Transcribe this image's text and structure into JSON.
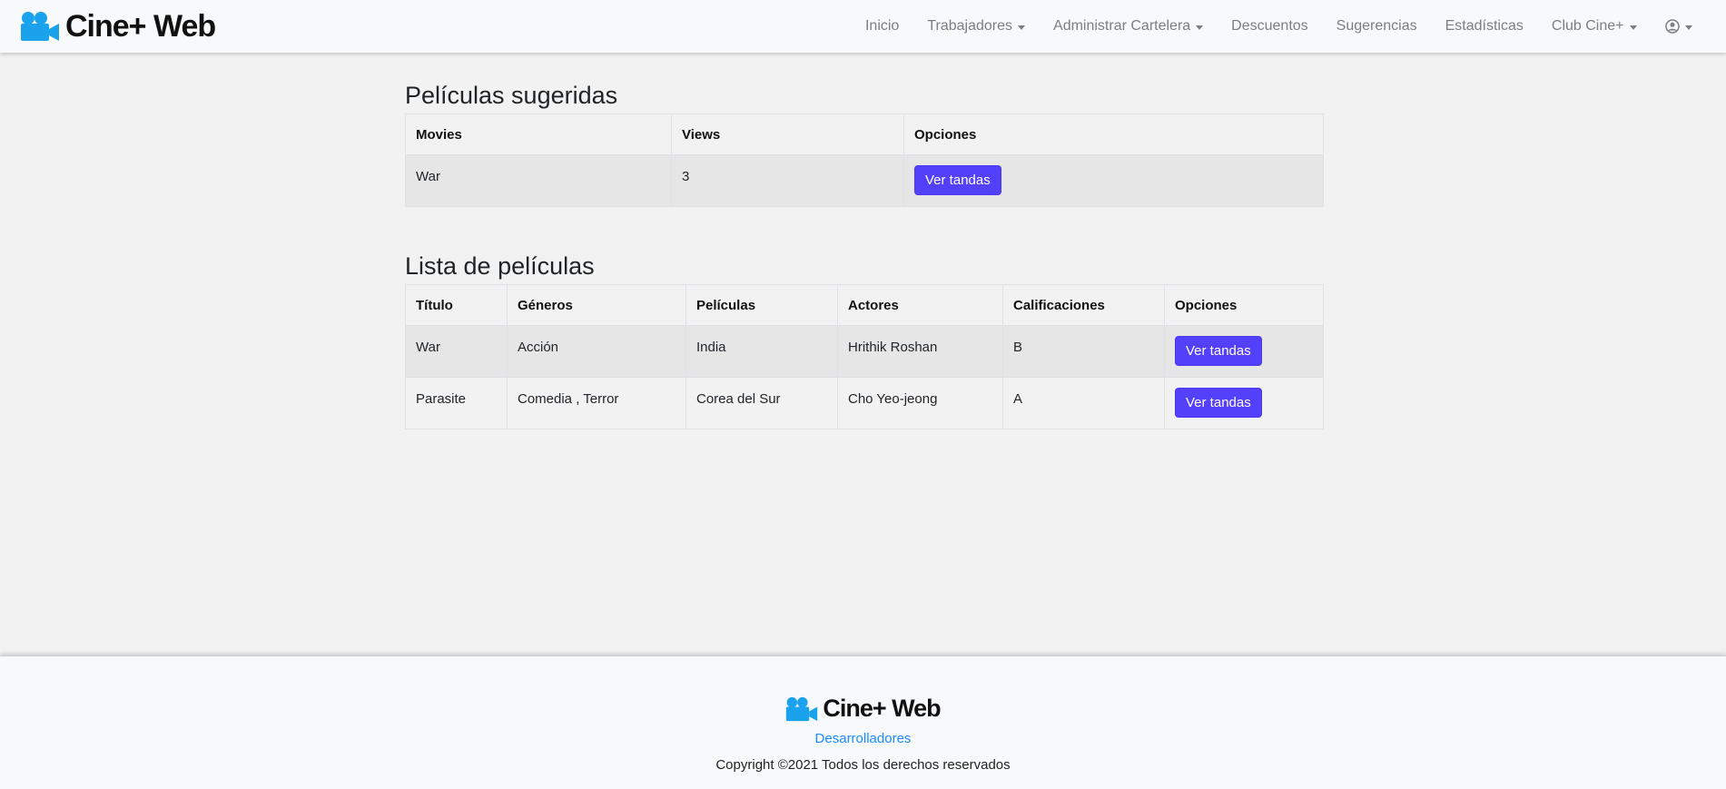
{
  "brand": {
    "name": "Cine+ Web",
    "icon": "movie-camera-icon",
    "color": "#1aa3ec"
  },
  "nav": {
    "items": [
      {
        "label": "Inicio",
        "dropdown": false
      },
      {
        "label": "Trabajadores",
        "dropdown": true
      },
      {
        "label": "Administrar Cartelera",
        "dropdown": true
      },
      {
        "label": "Descuentos",
        "dropdown": false
      },
      {
        "label": "Sugerencias",
        "dropdown": false
      },
      {
        "label": "Estadísticas",
        "dropdown": false
      },
      {
        "label": "Club Cine+",
        "dropdown": true
      }
    ],
    "user_icon": "user-circle-icon"
  },
  "suggested": {
    "title": "Películas sugeridas",
    "columns": [
      "Movies",
      "Views",
      "Opciones"
    ],
    "rows": [
      {
        "movie": "War",
        "views": "3",
        "action": "Ver tandas"
      }
    ]
  },
  "movies": {
    "title": "Lista de películas",
    "columns": [
      "Título",
      "Géneros",
      "Películas",
      "Actores",
      "Calificaciones",
      "Opciones"
    ],
    "rows": [
      {
        "titulo": "War",
        "generos": "Acción",
        "peliculas": "India",
        "actores": "Hrithik Roshan",
        "calificacion": "B",
        "action": "Ver tandas"
      },
      {
        "titulo": "Parasite",
        "generos": "Comedia , Terror",
        "peliculas": "Corea del Sur",
        "actores": "Cho Yeo-jeong",
        "calificacion": "A",
        "action": "Ver tandas"
      }
    ]
  },
  "footer": {
    "brand": "Cine+ Web",
    "link": "Desarrolladores",
    "copyright": "Copyright ©2021 Todos los derechos reservados"
  },
  "colors": {
    "primary_button": "#5340fa",
    "link": "#1a8cff",
    "brand_icon": "#1aa3ec"
  }
}
